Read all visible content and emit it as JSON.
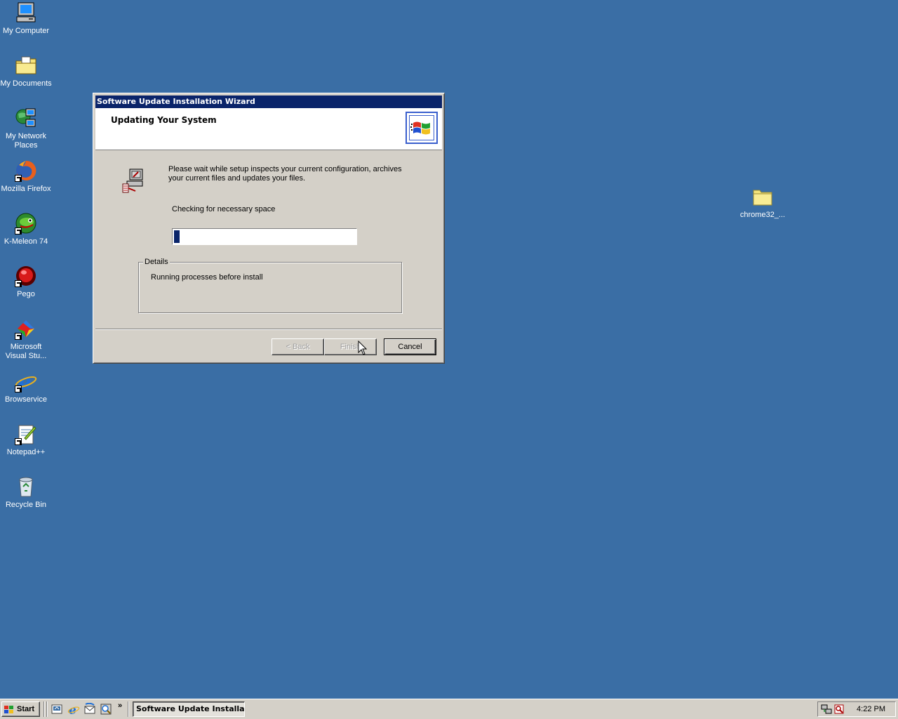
{
  "desktop": {
    "icons": [
      {
        "label": "My Computer",
        "icon": "my-computer-icon"
      },
      {
        "label": "My Documents",
        "icon": "my-documents-icon"
      },
      {
        "label": "My Network Places",
        "icon": "network-places-icon"
      },
      {
        "label": "Mozilla Firefox",
        "icon": "firefox-icon"
      },
      {
        "label": "K-Meleon 74",
        "icon": "k-meleon-icon"
      },
      {
        "label": "Pego",
        "icon": "pego-icon"
      },
      {
        "label": "Microsoft Visual Stu...",
        "icon": "visual-studio-icon"
      },
      {
        "label": "Browservice",
        "icon": "internet-explorer-icon"
      },
      {
        "label": "Notepad++",
        "icon": "notepad-plus-plus-icon"
      },
      {
        "label": "Recycle Bin",
        "icon": "recycle-bin-icon"
      }
    ],
    "folder": {
      "label": "chrome32_...",
      "icon": "folder-icon"
    }
  },
  "wizard": {
    "title": "Software Update Installation Wizard",
    "header_title": "Updating Your System",
    "message_line1": "Please wait while setup inspects your current configuration, archives",
    "message_line2": "your current files and updates your files.",
    "status": "Checking for necessary space",
    "progress_fraction": 0.03,
    "details_legend": "Details",
    "details_text": "Running processes before install",
    "buttons": {
      "back": "< Back",
      "finish": "Finish",
      "cancel": "Cancel"
    }
  },
  "taskbar": {
    "start_label": "Start",
    "quick_launch": [
      "show-desktop-icon",
      "internet-explorer-icon",
      "outlook-express-icon",
      "media-icon"
    ],
    "more": "»",
    "task_label": "Software Update Installa...",
    "clock": "4:22 PM"
  },
  "colors": {
    "desktop": "#3a6ea5",
    "titlebar": "#0a246a",
    "face": "#d4d0c8"
  }
}
